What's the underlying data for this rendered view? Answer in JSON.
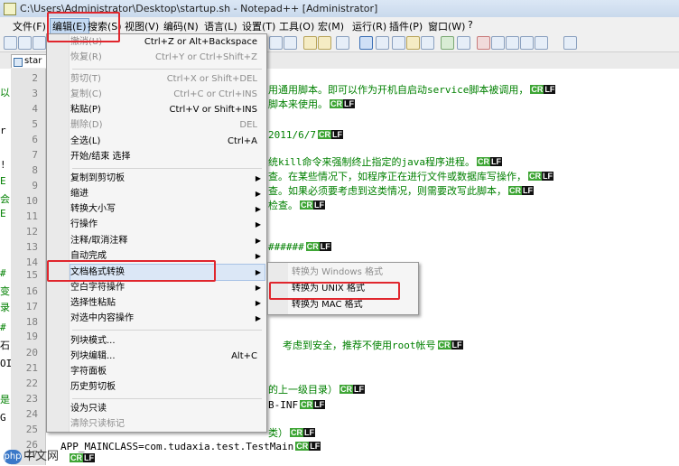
{
  "window": {
    "title": "C:\\Users\\Administrator\\Desktop\\startup.sh - Notepad++ [Administrator]"
  },
  "menubar": {
    "items": [
      "文件(F)",
      "编辑(E)",
      "搜索(S)",
      "视图(V)",
      "编码(N)",
      "语言(L)",
      "设置(T)",
      "工具(O)",
      "宏(M)",
      "运行(R)",
      "插件(P)",
      "窗口(W)",
      "?"
    ]
  },
  "tab": {
    "label": "star"
  },
  "left_pane": {
    "chars": [
      "以",
      "r",
      "!",
      "E",
      "会",
      "E",
      "#",
      "变",
      "录",
      "#",
      "石",
      "OI",
      "是",
      "G"
    ]
  },
  "gutter": {
    "lines": [
      "2",
      "3",
      "4",
      "5",
      "6",
      "7",
      "8",
      "9",
      "10",
      "11",
      "12",
      "13",
      "14",
      "15",
      "16",
      "17",
      "18",
      "19",
      "20",
      "21",
      "22",
      "23",
      "24",
      "25",
      "26",
      "27",
      "28"
    ]
  },
  "editor": {
    "fragments": [
      "用通用脚本。即可以作为开机自启动service脚本被调用，",
      "脚本来使用。",
      "2011/6/7",
      "统kill命令来强制终止指定的java程序进程。",
      "查。在某些情况下，如程序正在进行文件或数据库写操作，",
      "查。如果必须要考虑到这类情况，则需要改写此脚本，",
      "检查。",
      "######",
      "考虑到安全，推荐不使用root帐号",
      "的上一级目录）",
      "B-INF",
      "类）",
      "APP_MAINCLASS=com.tudaxia.test.TestMain"
    ],
    "eol_cr": "CR",
    "eol_lf": "LF"
  },
  "edit_menu": {
    "undo": {
      "label": "撤消(U)",
      "shortcut": "Ctrl+Z or Alt+Backspace"
    },
    "redo": {
      "label": "恢复(R)",
      "shortcut": "Ctrl+Y or Ctrl+Shift+Z"
    },
    "cut": {
      "label": "剪切(T)",
      "shortcut": "Ctrl+X or Shift+DEL"
    },
    "copy": {
      "label": "复制(C)",
      "shortcut": "Ctrl+C or Ctrl+INS"
    },
    "paste": {
      "label": "粘贴(P)",
      "shortcut": "Ctrl+V or Shift+INS"
    },
    "delete": {
      "label": "删除(D)",
      "shortcut": "DEL"
    },
    "select_all": {
      "label": "全选(L)",
      "shortcut": "Ctrl+A"
    },
    "begin_end_select": {
      "label": "开始/结束 选择"
    },
    "copy_to_clipboard": {
      "label": "复制到剪切板"
    },
    "indent": {
      "label": "缩进"
    },
    "convert_case": {
      "label": "转换大小写"
    },
    "line_ops": {
      "label": "行操作"
    },
    "comment": {
      "label": "注释/取消注释"
    },
    "autocomplete": {
      "label": "自动完成"
    },
    "eol_conversion": {
      "label": "文档格式转换"
    },
    "blank_ops": {
      "label": "空白字符操作"
    },
    "paste_special": {
      "label": "选择性粘贴"
    },
    "on_selection": {
      "label": "对选中内容操作"
    },
    "column_mode": {
      "label": "列块模式..."
    },
    "column_editor": {
      "label": "列块编辑...",
      "shortcut": "Alt+C"
    },
    "char_panel": {
      "label": "字符面板"
    },
    "clipboard_history": {
      "label": "历史剪切板"
    },
    "set_readonly": {
      "label": "设为只读"
    },
    "clear_readonly": {
      "label": "清除只读标记"
    }
  },
  "eol_submenu": {
    "to_windows": "转换为 Windows 格式",
    "to_unix": "转换为 UNIX 格式",
    "to_mac": "转换为 MAC 格式"
  },
  "watermark": {
    "logo": "php",
    "text": "中文网"
  },
  "colors": {
    "highlight_red": "#e0262d",
    "comment_green": "#008000",
    "cr_badge": "#3ea535",
    "lf_badge": "#111111",
    "menu_hover": "#dbe7f6"
  }
}
